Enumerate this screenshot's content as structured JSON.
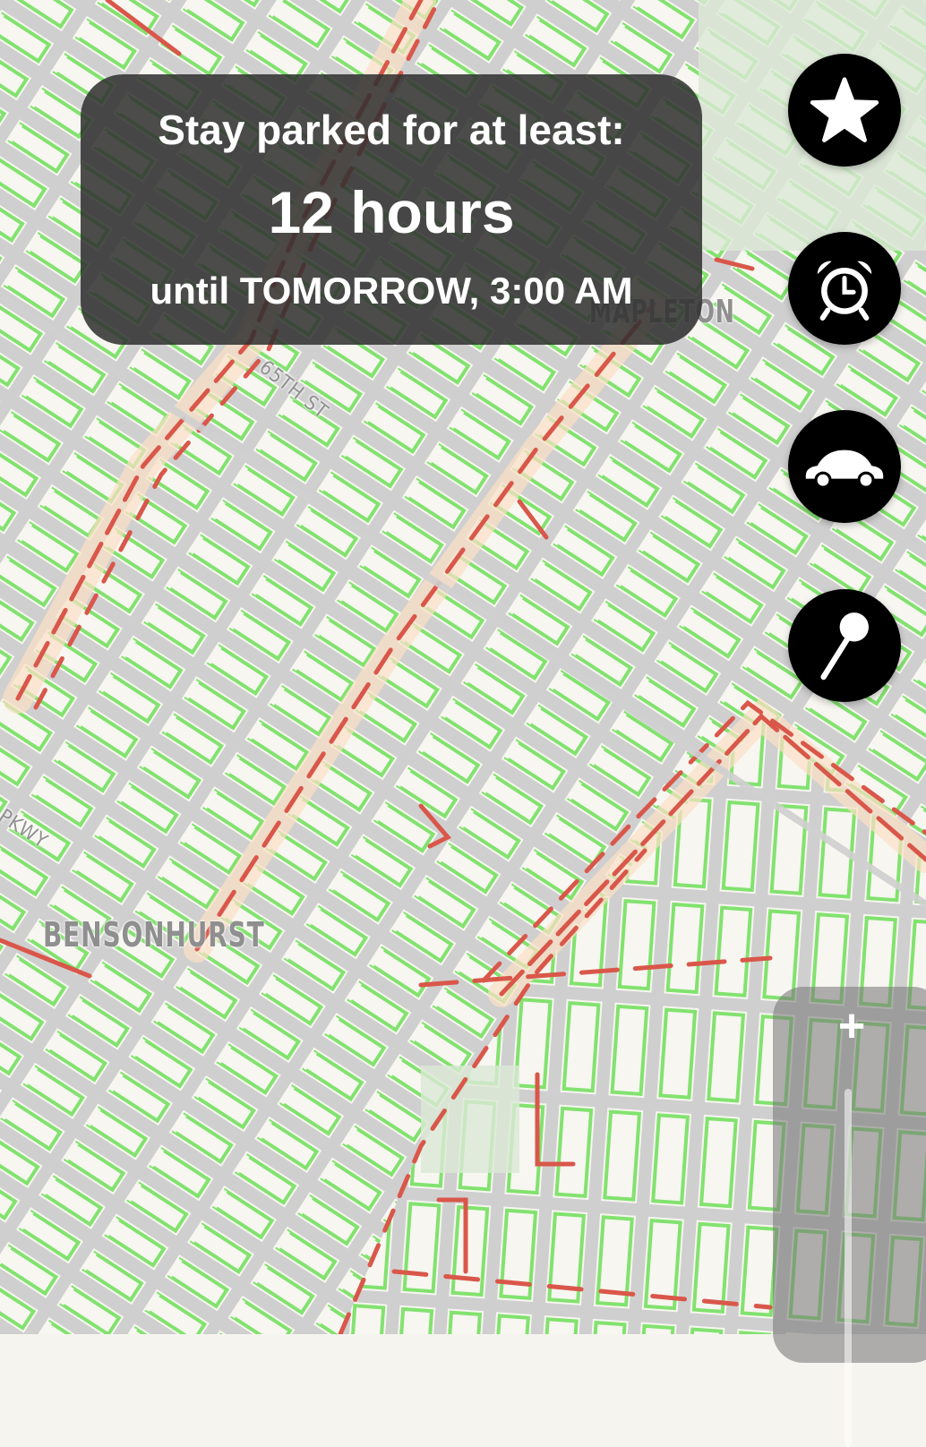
{
  "info_panel": {
    "line1": "Stay parked for at least:",
    "line2": "12 hours",
    "line3": "until TOMORROW, 3:00 AM"
  },
  "map": {
    "labels": {
      "bensonhurst": "BENSONHURST",
      "mapleton": "MAPLETON",
      "street_65th": "65TH ST",
      "parkway": "E PKWY"
    },
    "colors": {
      "background": "#f6f4ee",
      "road": "#cfcfcf",
      "parking_ok": "#7fe06c",
      "parking_restricted": "#d9574a",
      "highlight_street": "#fbdfc4",
      "park": "#dbe9d6"
    }
  },
  "controls": {
    "buttons": [
      {
        "name": "favorites",
        "icon": "star-icon"
      },
      {
        "name": "alarm",
        "icon": "alarm-clock-icon"
      },
      {
        "name": "car",
        "icon": "car-icon"
      },
      {
        "name": "pin",
        "icon": "map-pin-icon"
      }
    ],
    "zoom_in_label": "+"
  }
}
